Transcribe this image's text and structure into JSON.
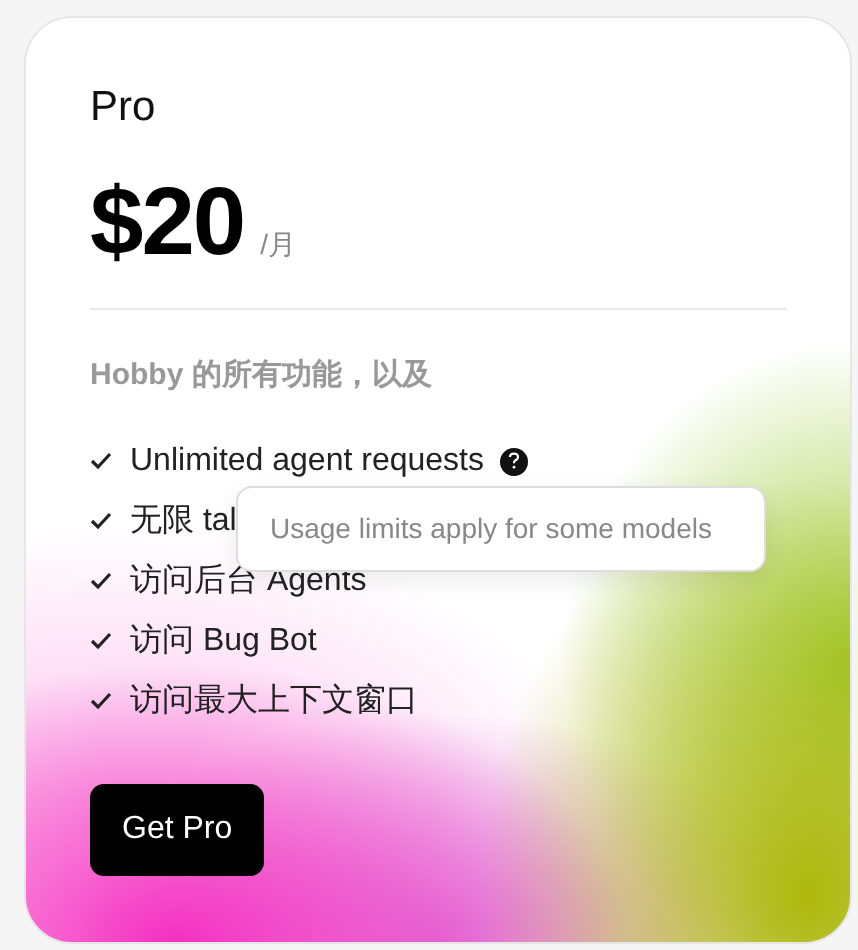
{
  "plan": {
    "name": "Pro",
    "price": "$20",
    "period": "/月"
  },
  "features_heading": "Hobby 的所有功能，以及",
  "features": [
    {
      "text": "Unlimited agent requests",
      "help": true
    },
    {
      "text": "无限 tal",
      "help": false
    },
    {
      "text": "访问后台 Agents",
      "help": false
    },
    {
      "text": "访问 Bug Bot",
      "help": false
    },
    {
      "text": "访问最大上下文窗口",
      "help": false
    }
  ],
  "tooltip": "Usage limits apply for some models",
  "button": "Get Pro"
}
